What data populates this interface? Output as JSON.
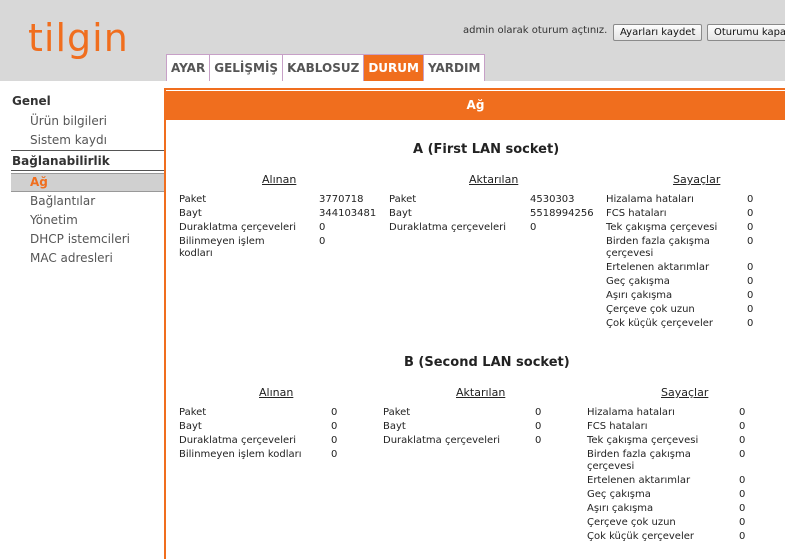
{
  "header": {
    "logo": "tilgin",
    "login_status": "admin olarak oturum açtınız.",
    "save_label": "Ayarları kaydet",
    "logout_label": "Oturumu kapat"
  },
  "tabs": [
    {
      "label": "AYAR"
    },
    {
      "label": "GELİŞMİŞ"
    },
    {
      "label": "KABLOSUZ"
    },
    {
      "label": "DURUM"
    },
    {
      "label": "YARDIM"
    }
  ],
  "sidebar": {
    "general_title": "Genel",
    "general_items": [
      "Ürün bilgileri",
      "Sistem kaydı"
    ],
    "conn_title": "Bağlanabilirlik",
    "conn_items": [
      "Ağ",
      "Bağlantılar",
      "Yönetim",
      "DHCP istemcileri",
      "MAC adresleri"
    ]
  },
  "page": {
    "title": "Ağ"
  },
  "sections": [
    {
      "title": "A (First LAN socket)",
      "received_head": "Alınan",
      "sent_head": "Aktarılan",
      "counters_head": "Sayaçlar",
      "received": [
        {
          "label": "Paket",
          "value": "3770718"
        },
        {
          "label": "Bayt",
          "value": "344103481"
        },
        {
          "label": "Duraklatma çerçeveleri",
          "value": "0"
        },
        {
          "label": "Bilinmeyen işlem kodları",
          "value": "0"
        }
      ],
      "sent": [
        {
          "label": "Paket",
          "value": "4530303"
        },
        {
          "label": "Bayt",
          "value": "5518994256"
        },
        {
          "label": "Duraklatma çerçeveleri",
          "value": "0"
        }
      ],
      "counters": [
        {
          "label": "Hizalama hataları",
          "value": "0"
        },
        {
          "label": "FCS hataları",
          "value": "0"
        },
        {
          "label": "Tek çakışma çerçevesi",
          "value": "0"
        },
        {
          "label": "Birden fazla çakışma çerçevesi",
          "value": "0"
        },
        {
          "label": "Ertelenen aktarımlar",
          "value": "0"
        },
        {
          "label": "Geç çakışma",
          "value": "0"
        },
        {
          "label": "Aşırı çakışma",
          "value": "0"
        },
        {
          "label": "Çerçeve çok uzun",
          "value": "0"
        },
        {
          "label": "Çok küçük çerçeveler",
          "value": "0"
        }
      ]
    },
    {
      "title": "B (Second LAN socket)",
      "received_head": "Alınan",
      "sent_head": "Aktarılan",
      "counters_head": "Sayaçlar",
      "received": [
        {
          "label": "Paket",
          "value": "0"
        },
        {
          "label": "Bayt",
          "value": "0"
        },
        {
          "label": "Duraklatma çerçeveleri",
          "value": "0"
        },
        {
          "label": "Bilinmeyen işlem kodları",
          "value": "0"
        }
      ],
      "sent": [
        {
          "label": "Paket",
          "value": "0"
        },
        {
          "label": "Bayt",
          "value": "0"
        },
        {
          "label": "Duraklatma çerçeveleri",
          "value": "0"
        }
      ],
      "counters": [
        {
          "label": "Hizalama hataları",
          "value": "0"
        },
        {
          "label": "FCS hataları",
          "value": "0"
        },
        {
          "label": "Tek çakışma çerçevesi",
          "value": "0"
        },
        {
          "label": "Birden fazla çakışma çerçevesi",
          "value": "0"
        },
        {
          "label": "Ertelenen aktarımlar",
          "value": "0"
        },
        {
          "label": "Geç çakışma",
          "value": "0"
        },
        {
          "label": "Aşırı çakışma",
          "value": "0"
        },
        {
          "label": "Çerçeve çok uzun",
          "value": "0"
        },
        {
          "label": "Çok küçük çerçeveler",
          "value": "0"
        }
      ]
    }
  ]
}
